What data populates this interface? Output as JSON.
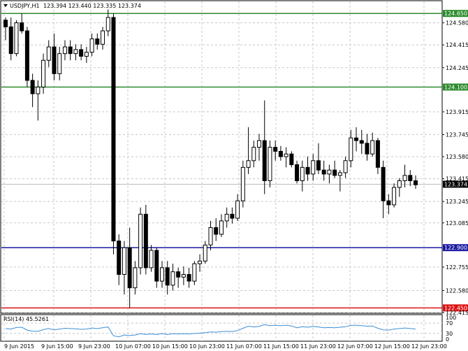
{
  "header": {
    "symbol": "USDJPY,H1",
    "ohlc": "123.394 123.440 123.335 123.374"
  },
  "chart_data": {
    "type": "candlestick",
    "price_axis": {
      "ticks": [
        "124.580",
        "124.415",
        "124.245",
        "123.915",
        "123.745",
        "123.580",
        "123.415",
        "123.245",
        "123.085",
        "122.755",
        "122.580",
        "122.415"
      ],
      "ylim": [
        122.41,
        124.74
      ]
    },
    "time_axis": {
      "ticks": [
        "9 Jun 2015",
        "9 Jun 15:00",
        "9 Jun 23:00",
        "10 Jun 07:00",
        "10 Jun 15:00",
        "10 Jun 23:00",
        "11 Jun 07:00",
        "11 Jun 15:00",
        "11 Jun 23:00",
        "12 Jun 07:00",
        "12 Jun 15:00",
        "12 Jun 23:00"
      ]
    },
    "levels": [
      {
        "value": 124.65,
        "label": "124.650",
        "color": "#2e8b2e"
      },
      {
        "value": 124.1,
        "label": "124.100",
        "color": "#2e8b2e"
      },
      {
        "value": 122.9,
        "label": "122.900",
        "color": "#1a1aa0"
      },
      {
        "value": 122.45,
        "label": "122.450",
        "color": "#dd1111"
      }
    ],
    "current_price": {
      "value": 123.374,
      "label": "123.374"
    },
    "candles": [
      [
        124.6,
        124.62,
        124.45,
        124.55
      ],
      [
        124.55,
        124.62,
        124.3,
        124.35
      ],
      [
        124.35,
        124.6,
        124.33,
        124.58
      ],
      [
        124.58,
        124.65,
        124.5,
        124.52
      ],
      [
        124.52,
        124.55,
        124.1,
        124.15
      ],
      [
        124.15,
        124.2,
        123.95,
        124.05
      ],
      [
        124.05,
        124.15,
        123.85,
        124.1
      ],
      [
        124.1,
        124.35,
        124.05,
        124.3
      ],
      [
        124.3,
        124.45,
        124.25,
        124.4
      ],
      [
        124.4,
        124.5,
        124.15,
        124.2
      ],
      [
        124.2,
        124.4,
        124.15,
        124.35
      ],
      [
        124.35,
        124.45,
        124.3,
        124.4
      ],
      [
        124.4,
        124.45,
        124.3,
        124.35
      ],
      [
        124.35,
        124.42,
        124.3,
        124.38
      ],
      [
        124.38,
        124.42,
        124.3,
        124.33
      ],
      [
        124.33,
        124.4,
        124.28,
        124.36
      ],
      [
        124.36,
        124.5,
        124.33,
        124.46
      ],
      [
        124.46,
        124.5,
        124.38,
        124.42
      ],
      [
        124.42,
        124.55,
        124.38,
        124.52
      ],
      [
        124.52,
        124.68,
        124.48,
        124.62
      ],
      [
        124.62,
        124.65,
        122.85,
        122.95
      ],
      [
        122.95,
        123.0,
        122.62,
        122.7
      ],
      [
        122.7,
        122.95,
        122.55,
        122.9
      ],
      [
        122.9,
        123.05,
        122.45,
        122.6
      ],
      [
        122.6,
        122.8,
        122.55,
        122.75
      ],
      [
        122.75,
        123.2,
        122.7,
        123.15
      ],
      [
        123.15,
        123.22,
        122.7,
        122.75
      ],
      [
        122.75,
        122.92,
        122.72,
        122.88
      ],
      [
        122.88,
        122.9,
        122.6,
        122.65
      ],
      [
        122.65,
        122.8,
        122.6,
        122.75
      ],
      [
        122.75,
        122.8,
        122.55,
        122.62
      ],
      [
        122.62,
        122.78,
        122.58,
        122.72
      ],
      [
        122.72,
        122.75,
        122.6,
        122.68
      ],
      [
        122.68,
        122.76,
        122.62,
        122.7
      ],
      [
        122.7,
        122.75,
        122.6,
        122.65
      ],
      [
        122.65,
        122.8,
        122.62,
        122.78
      ],
      [
        122.78,
        122.85,
        122.72,
        122.8
      ],
      [
        122.8,
        122.95,
        122.78,
        122.92
      ],
      [
        122.92,
        123.1,
        122.88,
        123.05
      ],
      [
        123.05,
        123.12,
        122.95,
        123.0
      ],
      [
        123.0,
        123.15,
        122.98,
        123.1
      ],
      [
        123.1,
        123.2,
        123.05,
        123.15
      ],
      [
        123.15,
        123.2,
        123.08,
        123.12
      ],
      [
        123.12,
        123.3,
        123.1,
        123.25
      ],
      [
        123.25,
        123.55,
        123.2,
        123.5
      ],
      [
        123.5,
        123.8,
        123.45,
        123.55
      ],
      [
        123.55,
        123.7,
        123.5,
        123.65
      ],
      [
        123.65,
        123.75,
        123.55,
        123.7
      ],
      [
        123.7,
        124.0,
        123.3,
        123.4
      ],
      [
        123.4,
        123.7,
        123.35,
        123.65
      ],
      [
        123.65,
        123.7,
        123.55,
        123.62
      ],
      [
        123.62,
        123.66,
        123.55,
        123.58
      ],
      [
        123.58,
        123.65,
        123.5,
        123.6
      ],
      [
        123.6,
        123.62,
        123.5,
        123.52
      ],
      [
        123.52,
        123.55,
        123.38,
        123.4
      ],
      [
        123.4,
        123.55,
        123.32,
        123.5
      ],
      [
        123.5,
        123.58,
        123.4,
        123.45
      ],
      [
        123.45,
        123.6,
        123.4,
        123.55
      ],
      [
        123.55,
        123.68,
        123.45,
        123.48
      ],
      [
        123.48,
        123.55,
        123.4,
        123.45
      ],
      [
        123.45,
        123.52,
        123.38,
        123.48
      ],
      [
        123.48,
        123.55,
        123.42,
        123.44
      ],
      [
        123.44,
        123.48,
        123.32,
        123.46
      ],
      [
        123.46,
        123.58,
        123.42,
        123.55
      ],
      [
        123.55,
        123.78,
        123.5,
        123.72
      ],
      [
        123.72,
        123.8,
        123.62,
        123.7
      ],
      [
        123.7,
        123.78,
        123.6,
        123.68
      ],
      [
        123.68,
        123.75,
        123.55,
        123.6
      ],
      [
        123.6,
        123.76,
        123.58,
        123.7
      ],
      [
        123.7,
        123.72,
        123.45,
        123.5
      ],
      [
        123.5,
        123.55,
        123.12,
        123.25
      ],
      [
        123.25,
        123.3,
        123.15,
        123.22
      ],
      [
        123.22,
        123.38,
        123.2,
        123.35
      ],
      [
        123.35,
        123.42,
        123.28,
        123.4
      ],
      [
        123.4,
        123.52,
        123.35,
        123.44
      ],
      [
        123.44,
        123.48,
        123.36,
        123.4
      ],
      [
        123.4,
        123.44,
        123.34,
        123.37
      ]
    ]
  },
  "rsi": {
    "label": "RSI(14) 45.5261",
    "ticks": [
      "100",
      "70",
      "30",
      "0"
    ],
    "levels": [
      70,
      30
    ],
    "values": [
      49,
      47,
      53,
      54,
      43,
      39,
      38,
      45,
      49,
      44,
      47,
      50,
      49,
      48,
      46,
      47,
      51,
      49,
      52,
      55,
      21,
      17,
      24,
      22,
      24,
      29,
      26,
      28,
      26,
      29,
      26,
      29,
      28,
      29,
      28,
      30,
      31,
      33,
      36,
      35,
      37,
      38,
      37,
      41,
      50,
      58,
      55,
      57,
      64,
      60,
      62,
      60,
      62,
      59,
      52,
      56,
      54,
      57,
      55,
      52,
      53,
      52,
      54,
      56,
      61,
      62,
      60,
      58,
      59,
      50,
      44,
      43,
      47,
      49,
      51,
      49,
      47
    ]
  },
  "colors": {
    "grid": "#c8c8c8",
    "candle": "#000000",
    "rsi_line": "#3c8fd6",
    "price_tag": "#000000"
  }
}
